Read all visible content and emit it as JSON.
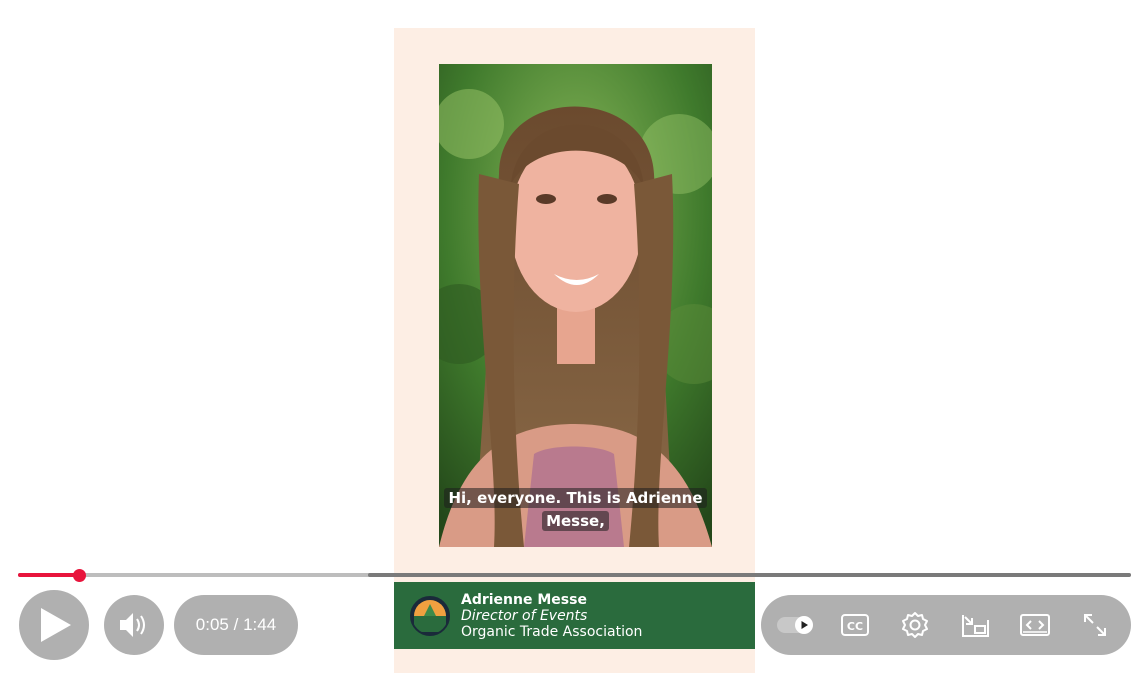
{
  "video": {
    "caption_line1": "Hi, everyone. This is Adrienne",
    "caption_line2": "Messe,",
    "lower_third": {
      "name": "Adrienne Messe",
      "role": "Director of Events",
      "organization": "Organic Trade Association"
    }
  },
  "player": {
    "progress_fraction": 0.0,
    "played_fraction": 0.055,
    "current_time": "0:05",
    "separator": "/",
    "duration": "1:44",
    "accent_color": "#e8143c",
    "icons": [
      "play-icon",
      "volume-icon",
      "autoplay-toggle-icon",
      "captions-icon",
      "settings-icon",
      "miniplayer-icon",
      "theater-mode-icon",
      "fullscreen-icon"
    ]
  }
}
